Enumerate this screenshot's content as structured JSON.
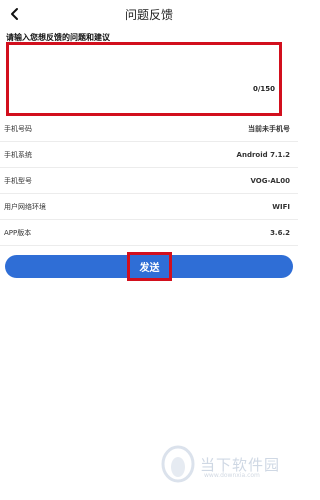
{
  "header": {
    "title": "问题反馈",
    "back_icon": "back-chevron-icon"
  },
  "feedback": {
    "prompt": "请输入您想反馈的问题和建议",
    "value": "",
    "counter": "0/150"
  },
  "info_rows": [
    {
      "label": "手机号码",
      "value": "当前未手机号"
    },
    {
      "label": "手机系统",
      "value": "Android 7.1.2"
    },
    {
      "label": "手机型号",
      "value": "VOG-AL00"
    },
    {
      "label": "用户网络环境",
      "value": "WIFI"
    },
    {
      "label": "APP版本",
      "value": "3.6.2"
    }
  ],
  "send_button": {
    "label": "发送",
    "color": "#2f6ed6"
  },
  "watermark": {
    "text": "当下软件园",
    "url": "www.downxia.com"
  },
  "colors": {
    "highlight": "#d20f1d",
    "button": "#2f6ed6"
  }
}
